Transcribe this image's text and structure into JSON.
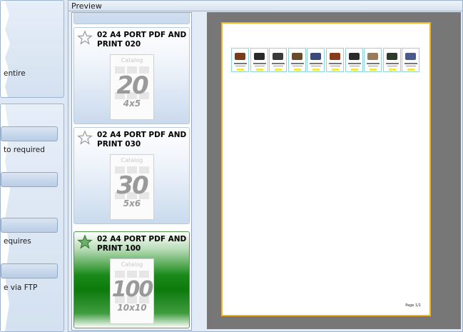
{
  "left_panel": {
    "texts": [
      "entire",
      "to required",
      "equires",
      "e via FTP"
    ]
  },
  "preview_header": {
    "title": "Preview"
  },
  "templates": [
    {
      "title": "02 A4 PORT PDF AND\nPRINT 020",
      "thumb_label": "Catalog",
      "thumb_number": "20",
      "thumb_grid": "4x5",
      "selected": false
    },
    {
      "title": "02 A4 PORT PDF AND\nPRINT 030",
      "thumb_label": "Catalog",
      "thumb_number": "30",
      "thumb_grid": "5x6",
      "selected": false
    },
    {
      "title": "02 A4 PORT PDF AND\nPRINT 100",
      "thumb_label": "Catalog",
      "thumb_number": "100",
      "thumb_grid": "10x10",
      "selected": true
    }
  ],
  "preview_page": {
    "footer": "Page 1/1",
    "products": [
      {
        "color": "#7a3a1c"
      },
      {
        "color": "#2a2a2a"
      },
      {
        "color": "#3a3a3a"
      },
      {
        "color": "#6b4a2a"
      },
      {
        "color": "#3b4a7a"
      },
      {
        "color": "#8a3a1c"
      },
      {
        "color": "#2a2a2a"
      },
      {
        "color": "#9a7a5a"
      },
      {
        "color": "#2f3b2a"
      },
      {
        "color": "#4a5a8a"
      }
    ]
  },
  "colors": {
    "selected_accent": "#0c7a0c",
    "page_border": "#f0b422",
    "preview_bg": "#777777"
  }
}
